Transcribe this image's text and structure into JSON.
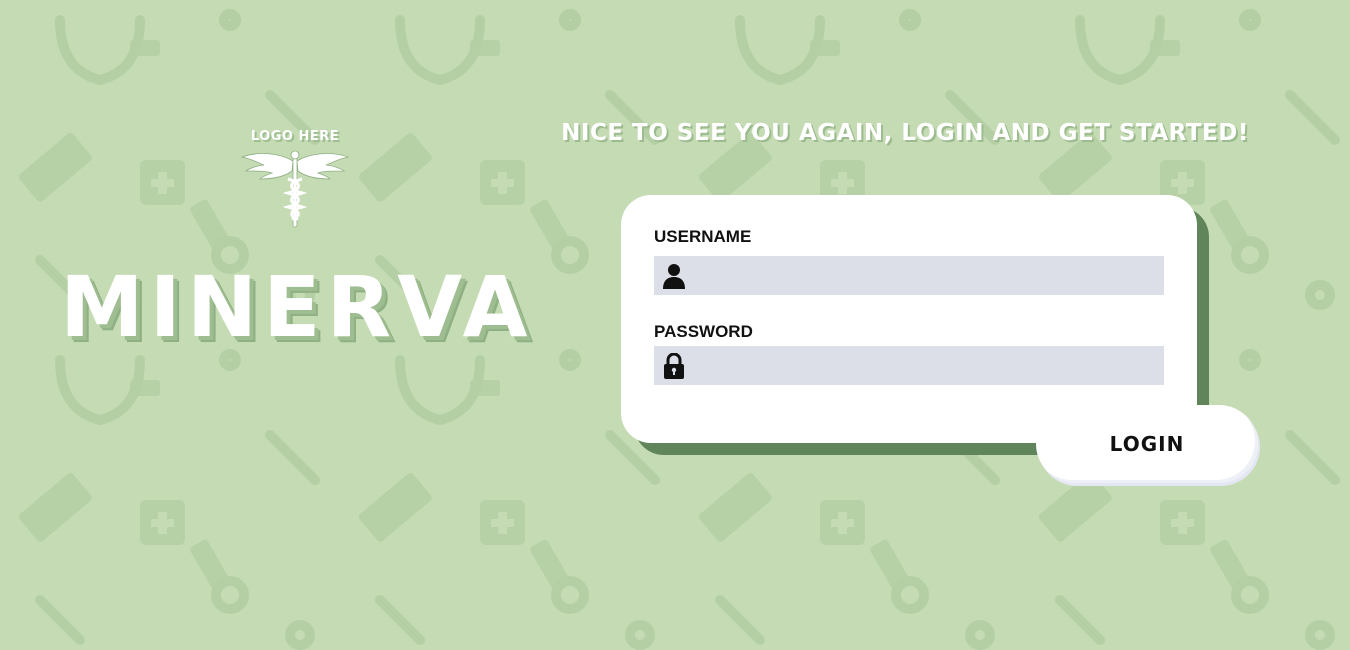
{
  "brand": {
    "logo_text": "LOGO HERE",
    "logo_icon": "caduceus-icon",
    "name": "MINERVA"
  },
  "greeting": "NICE TO SEE YOU AGAIN, LOGIN AND GET STARTED!",
  "form": {
    "username_label": "USERNAME",
    "username_value": "",
    "username_icon": "user-icon",
    "password_label": "PASSWORD",
    "password_value": "",
    "password_icon": "lock-icon",
    "login_label": "LOGIN"
  },
  "colors": {
    "background": "#c4dbb4",
    "card": "#ffffff",
    "card_shadow": "#61855a",
    "field": "#dcdfe8",
    "text": "#111111"
  }
}
